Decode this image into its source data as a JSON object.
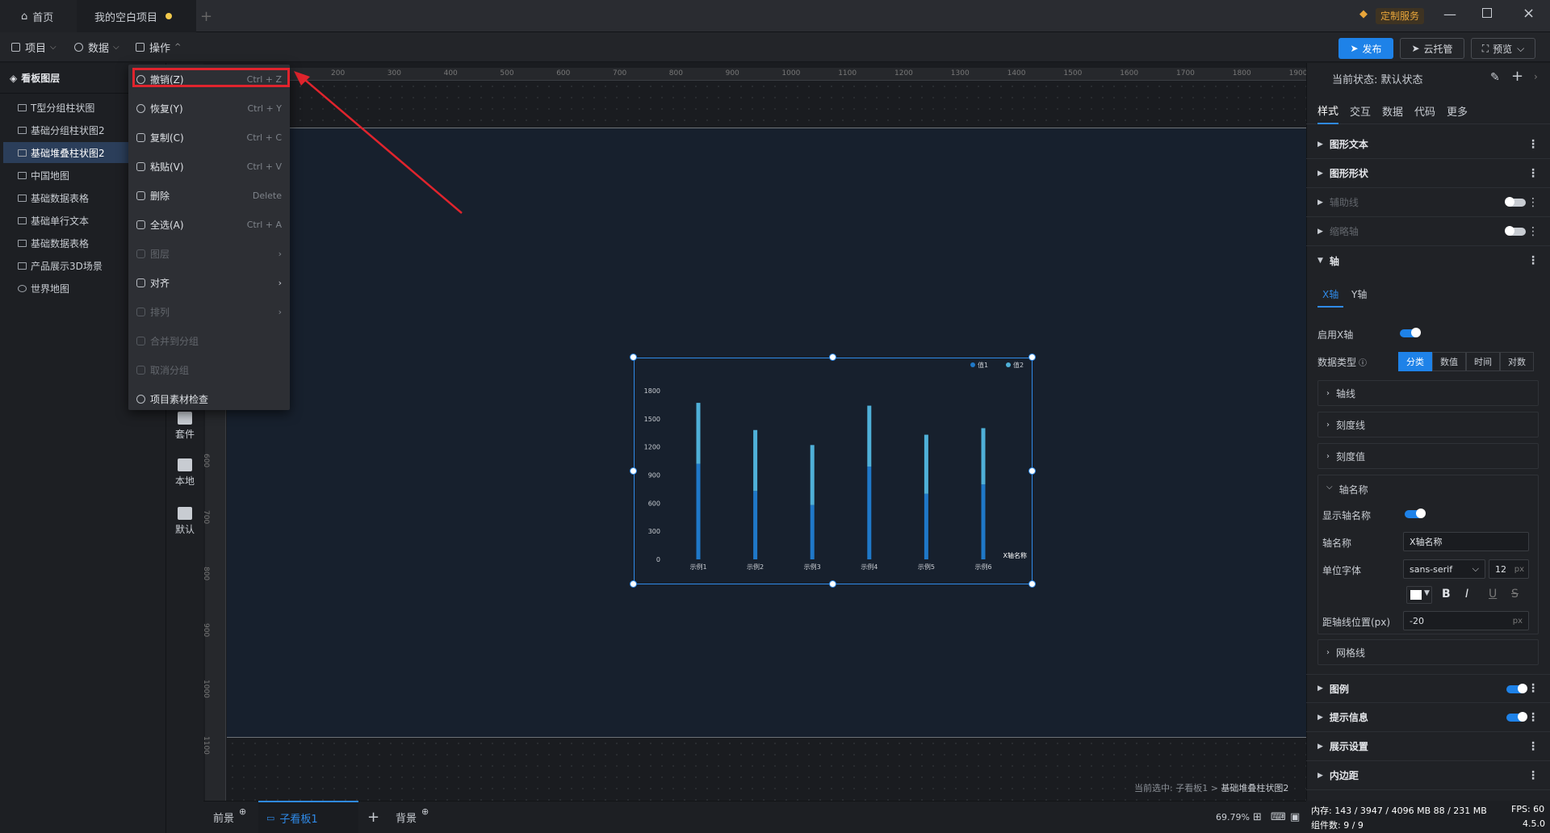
{
  "titlebar": {
    "home": "首页",
    "project": "我的空白项目",
    "custom_service": "定制服务"
  },
  "menu": {
    "project": "项目",
    "data": "数据",
    "operate": "操作",
    "publish": "发布",
    "cloud": "云托管",
    "preview": "预览"
  },
  "layers": {
    "title": "看板图层",
    "items": [
      "T型分组柱状图",
      "基础分组柱状图2",
      "基础堆叠柱状图2",
      "中国地图",
      "基础数据表格",
      "基础单行文本",
      "基础数据表格",
      "产品展示3D场景",
      "世界地图"
    ]
  },
  "tools": {
    "kit": "套件",
    "local": "本地",
    "default": "默认"
  },
  "dropdown": [
    {
      "label": "撤销(Z)",
      "shortcut": "Ctrl + Z"
    },
    {
      "label": "恢复(Y)",
      "shortcut": "Ctrl + Y"
    },
    {
      "label": "复制(C)",
      "shortcut": "Ctrl + C"
    },
    {
      "label": "粘贴(V)",
      "shortcut": "Ctrl + V"
    },
    {
      "label": "删除",
      "shortcut": "Delete"
    },
    {
      "label": "全选(A)",
      "shortcut": "Ctrl + A"
    },
    {
      "label": "图层",
      "shortcut": "›"
    },
    {
      "label": "对齐",
      "shortcut": "›"
    },
    {
      "label": "排列",
      "shortcut": "›"
    },
    {
      "label": "合并到分组",
      "shortcut": ""
    },
    {
      "label": "取消分组",
      "shortcut": ""
    },
    {
      "label": "项目素材检查",
      "shortcut": ""
    }
  ],
  "ruler": {
    "top": [
      "200",
      "300",
      "400",
      "500",
      "600",
      "700",
      "800",
      "900",
      "1000",
      "1100",
      "1200",
      "1300",
      "1400",
      "1500",
      "1600",
      "1700",
      "1800",
      "1900"
    ],
    "left": [
      "600",
      "700",
      "800",
      "900",
      "1000",
      "1100"
    ]
  },
  "chart_data": {
    "type": "bar",
    "stacked": true,
    "categories": [
      "示例1",
      "示例2",
      "示例3",
      "示例4",
      "示例5",
      "示例6"
    ],
    "series": [
      {
        "name": "值1",
        "values": [
          1020,
          730,
          580,
          990,
          700,
          800
        ]
      },
      {
        "name": "值2",
        "values": [
          650,
          650,
          640,
          650,
          630,
          600
        ]
      }
    ],
    "yticks": [
      "1800",
      "1500",
      "1200",
      "900",
      "600",
      "300",
      "0"
    ],
    "ylim": [
      0,
      1800
    ],
    "xlabel": "X轴名称",
    "legend": "top-right",
    "colors": {
      "v1": "#1f78c8",
      "v2": "#4fb0d8"
    }
  },
  "breadcrumb": {
    "prefix": "当前选中: 子看板1 > ",
    "current": "基础堆叠柱状图2"
  },
  "bottom": {
    "front": "前景",
    "sub": "子看板1",
    "back": "背景",
    "zoom": "69.79%"
  },
  "right": {
    "state": "当前状态: 默认状态",
    "tabs": [
      "样式",
      "交互",
      "数据",
      "代码",
      "更多"
    ],
    "sections": {
      "shape_text": "图形文本",
      "shape_form": "图形形状",
      "aux": "辅助线",
      "zoom_axis": "缩略轴",
      "axis": "轴",
      "legend": "图例",
      "tooltip": "提示信息",
      "display": "展示设置",
      "padding": "内边距"
    },
    "axis_tabs": [
      "X轴",
      "Y轴"
    ],
    "enable_x": "启用X轴",
    "data_type": "数据类型",
    "data_types": [
      "分类",
      "数值",
      "时间",
      "对数"
    ],
    "subs": {
      "axis_line": "轴线",
      "tick_line": "刻度线",
      "tick_value": "刻度值",
      "axis_name": "轴名称",
      "grid": "网格线"
    },
    "show_axis_name": "显示轴名称",
    "axis_name_label": "轴名称",
    "axis_name_value": "X轴名称",
    "unit_font": "单位字体",
    "font_value": "sans-serif",
    "font_size": "12",
    "px": "px",
    "offset_label": "距轴线位置(px)",
    "offset_value": "-20"
  },
  "status": {
    "memory": "内存: 143 / 3947 / 4096 MB  88 / 231 MB",
    "fps": "FPS: 60",
    "components": "组件数: 9 / 9",
    "version": "4.5.0"
  }
}
